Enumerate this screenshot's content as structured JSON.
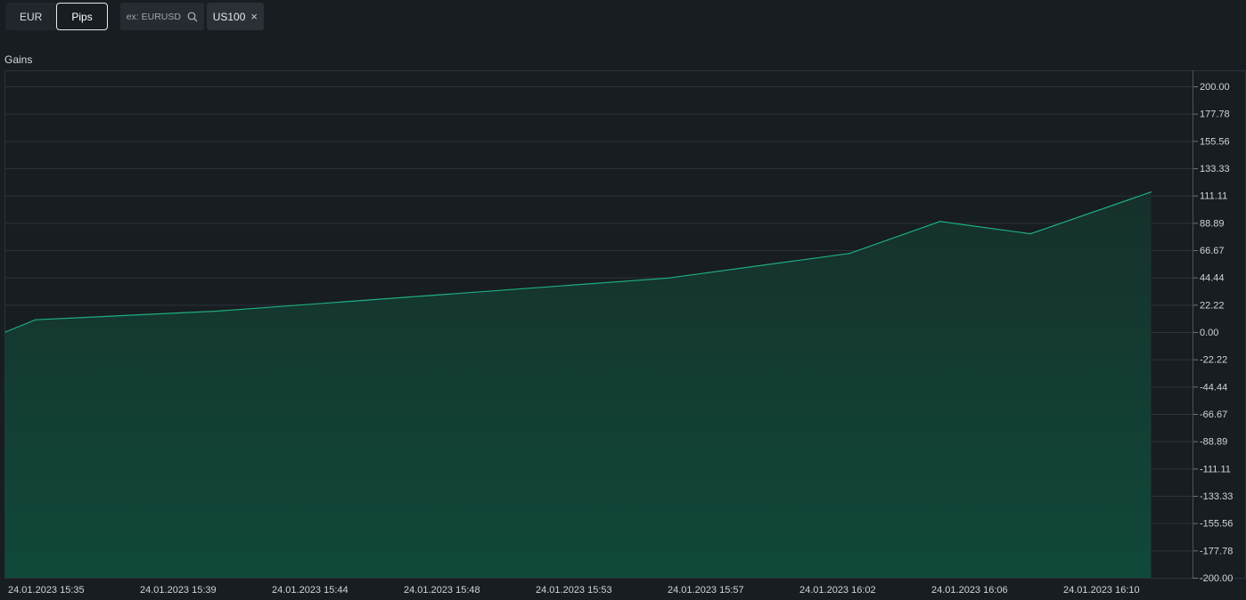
{
  "toolbar": {
    "unit_toggle": [
      {
        "label": "EUR",
        "active": false
      },
      {
        "label": "Pips",
        "active": true
      }
    ],
    "search": {
      "placeholder": "ex: EURUSD",
      "value": ""
    },
    "chip": {
      "label": "US100",
      "close_symbol": "×"
    }
  },
  "colors": {
    "background": "#181d22",
    "line": "#1fae7e",
    "area_fill": "#0f4a3a",
    "grid": "#2a3338"
  },
  "chart_data": {
    "type": "area",
    "title": "Gains",
    "xlabel": "",
    "ylabel": "",
    "ylim": [
      -200,
      200
    ],
    "yticks": [
      "200.00",
      "177.78",
      "155.56",
      "133.33",
      "111.11",
      "88.89",
      "66.67",
      "44.44",
      "22.22",
      "0.00",
      "-22.22",
      "-44.44",
      "-66.67",
      "-88.89",
      "-111.11",
      "-133.33",
      "-155.56",
      "-177.78",
      "-200.00"
    ],
    "xticks": [
      "24.01.2023 15:35",
      "24.01.2023 15:39",
      "24.01.2023 15:44",
      "24.01.2023 15:48",
      "24.01.2023 15:53",
      "24.01.2023 15:57",
      "24.01.2023 16:02",
      "24.01.2023 16:06",
      "24.01.2023 16:10"
    ],
    "grid": true,
    "y_axis_position": "right",
    "series": [
      {
        "x": [
          "24.01.2023 15:35",
          "24.01.2023 15:36",
          "24.01.2023 15:42",
          "24.01.2023 15:57",
          "24.01.2023 16:03",
          "24.01.2023 16:06",
          "24.01.2023 16:09",
          "24.01.2023 16:13"
        ],
        "values": [
          0.0,
          10.0,
          17.0,
          44.0,
          64.0,
          90.0,
          80.0,
          114.0
        ]
      }
    ]
  }
}
